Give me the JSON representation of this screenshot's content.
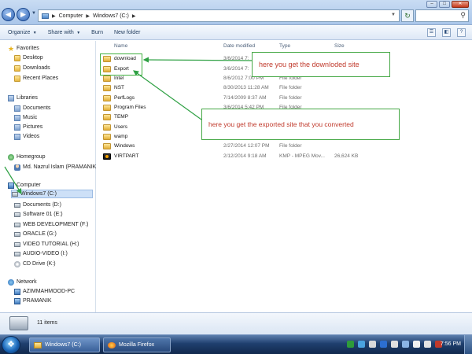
{
  "address": {
    "crumbs": [
      "Computer",
      "Windows7 (C:)"
    ]
  },
  "toolbar": {
    "organize": "Organize",
    "share": "Share with",
    "burn": "Burn",
    "new_folder": "New folder"
  },
  "sidebar": {
    "favorites": {
      "title": "Favorites",
      "items": [
        "Desktop",
        "Downloads",
        "Recent Places"
      ]
    },
    "libraries": {
      "title": "Libraries",
      "items": [
        "Documents",
        "Music",
        "Pictures",
        "Videos"
      ]
    },
    "homegroup": {
      "title": "Homegroup",
      "items": [
        "Md. Nazrul Islam (PRAMANIK"
      ]
    },
    "computer": {
      "title": "Computer",
      "items": [
        "Windows7 (C:)",
        "Documents (D:)",
        "Software 01 (E:)",
        "WEB DEVELOPMENT (F:)",
        "ORACLE (G:)",
        "VIDEO TUTORIAL (H:)",
        "AUDIO-VIDEO (I:)",
        "CD Drive (K:)"
      ]
    },
    "network": {
      "title": "Network",
      "items": [
        "AZIMMAHMOOD-PC",
        "PRAMANIK"
      ]
    }
  },
  "columns": {
    "name": "Name",
    "date": "Date modified",
    "type": "Type",
    "size": "Size"
  },
  "files": [
    {
      "name": "download",
      "date": "3/6/2014 7:",
      "type": "",
      "size": ""
    },
    {
      "name": "Export",
      "date": "3/6/2014 7:",
      "type": "",
      "size": ""
    },
    {
      "name": "Intel",
      "date": "8/6/2012 7:00 PM",
      "type": "File folder",
      "size": ""
    },
    {
      "name": "NST",
      "date": "8/30/2013 11:28 AM",
      "type": "File folder",
      "size": ""
    },
    {
      "name": "PerfLogs",
      "date": "7/14/2009 8:37 AM",
      "type": "File folder",
      "size": ""
    },
    {
      "name": "Program Files",
      "date": "3/6/2014 5:42 PM",
      "type": "File folder",
      "size": ""
    },
    {
      "name": "TEMP",
      "date": "",
      "type": "",
      "size": ""
    },
    {
      "name": "Users",
      "date": "",
      "type": "",
      "size": ""
    },
    {
      "name": "wamp",
      "date": "",
      "type": "",
      "size": ""
    },
    {
      "name": "Windows",
      "date": "2/27/2014 12:07 PM",
      "type": "File folder",
      "size": ""
    },
    {
      "name": "VIRTPART",
      "date": "2/12/2014 9:18 AM",
      "type": "KMP - MPEG Mov...",
      "size": "26,624 KB"
    }
  ],
  "annotations": {
    "download_note": "here you get the downloded site",
    "export_note": "here you get the exported site that you converted"
  },
  "details": {
    "count": "11 items"
  },
  "taskbar": {
    "task1": "Windows7 (C:)",
    "task2": "Mozilla Firefox",
    "clock": "7:56 PM"
  },
  "colors": {
    "annotation_border": "#3fae3f",
    "annotation_text": "#c0392b",
    "arrow": "#2ea043"
  }
}
